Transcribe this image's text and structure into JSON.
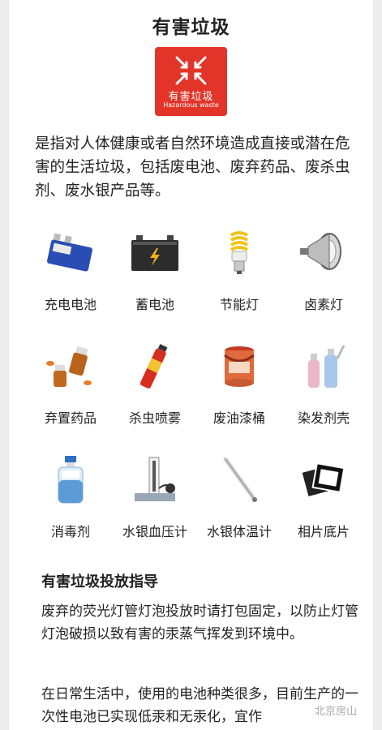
{
  "header": {
    "title": "有害垃圾"
  },
  "logo": {
    "label_cn": "有害垃圾",
    "label_en": "Hazardous waste",
    "color": "#e3342a"
  },
  "intro": "是指对人体健康或者自然环境造成直接或潜在危害的生活垃圾，包括废电池、废弃药品、废杀虫剂、废水银产品等。",
  "items": [
    {
      "label": "充电电池",
      "icon": "rechargeable-battery-icon"
    },
    {
      "label": "蓄电池",
      "icon": "car-battery-icon"
    },
    {
      "label": "节能灯",
      "icon": "energy-saving-bulb-icon"
    },
    {
      "label": "卤素灯",
      "icon": "halogen-lamp-icon"
    },
    {
      "label": "弃置药品",
      "icon": "medicine-bottles-icon"
    },
    {
      "label": "杀虫喷雾",
      "icon": "insecticide-spray-icon"
    },
    {
      "label": "废油漆桶",
      "icon": "paint-bucket-icon"
    },
    {
      "label": "染发剂壳",
      "icon": "hair-dye-tubes-icon"
    },
    {
      "label": "消毒剂",
      "icon": "disinfectant-bottle-icon"
    },
    {
      "label": "水银血压计",
      "icon": "mercury-sphygmomanometer-icon"
    },
    {
      "label": "水银体温计",
      "icon": "mercury-thermometer-icon"
    },
    {
      "label": "相片底片",
      "icon": "photo-film-icon"
    }
  ],
  "guide": {
    "title": "有害垃圾投放指导",
    "paragraph1": "废弃的荧光灯管灯泡投放时请打包固定，以防止灯管灯泡破损以致有害的汞蒸气挥发到环境中。",
    "paragraph2": "在日常生活中，使用的电池种类很多，目前生产的一次性电池已实现低汞和无汞化，宜作"
  },
  "watermark": "北京房山"
}
